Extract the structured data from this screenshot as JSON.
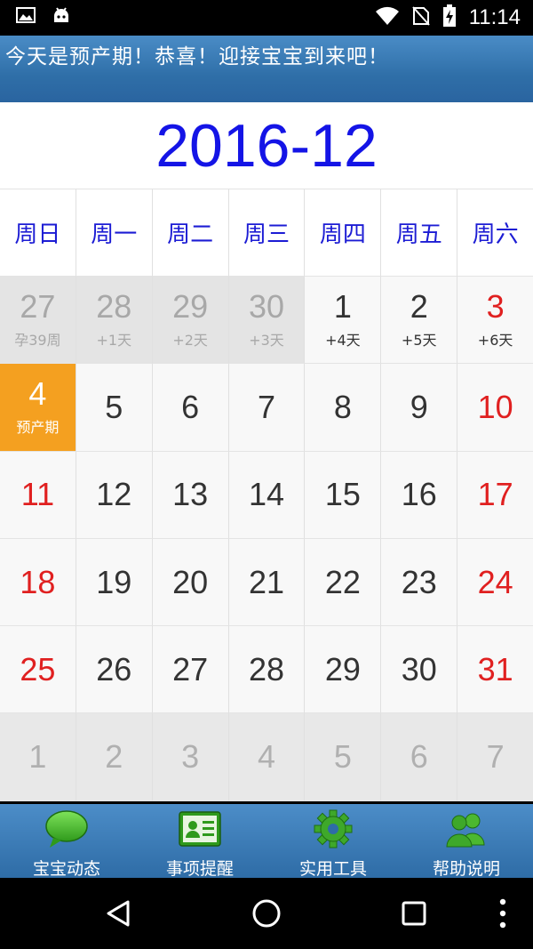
{
  "status_bar": {
    "time": "11:14",
    "icons": [
      "image-icon",
      "android-icon",
      "wifi-icon",
      "no-sim-icon",
      "battery-charging-icon"
    ]
  },
  "banner": {
    "text": "今天是预产期！恭喜！迎接宝宝到来吧！"
  },
  "calendar": {
    "month_title": "2016-12",
    "weekdays": [
      "周日",
      "周一",
      "周二",
      "周三",
      "周四",
      "周五",
      "周六"
    ],
    "weeks": [
      [
        {
          "day": "27",
          "sub": "孕39周",
          "type": "prev"
        },
        {
          "day": "28",
          "sub": "+1天",
          "type": "prev"
        },
        {
          "day": "29",
          "sub": "+2天",
          "type": "prev"
        },
        {
          "day": "30",
          "sub": "+3天",
          "type": "prev"
        },
        {
          "day": "1",
          "sub": "+4天",
          "type": "current"
        },
        {
          "day": "2",
          "sub": "+5天",
          "type": "current"
        },
        {
          "day": "3",
          "sub": "+6天",
          "type": "weekend"
        }
      ],
      [
        {
          "day": "4",
          "sub": "预产期",
          "type": "today"
        },
        {
          "day": "5",
          "sub": "",
          "type": "current"
        },
        {
          "day": "6",
          "sub": "",
          "type": "current"
        },
        {
          "day": "7",
          "sub": "",
          "type": "current"
        },
        {
          "day": "8",
          "sub": "",
          "type": "current"
        },
        {
          "day": "9",
          "sub": "",
          "type": "current"
        },
        {
          "day": "10",
          "sub": "",
          "type": "weekend"
        }
      ],
      [
        {
          "day": "11",
          "sub": "",
          "type": "weekend"
        },
        {
          "day": "12",
          "sub": "",
          "type": "current"
        },
        {
          "day": "13",
          "sub": "",
          "type": "current"
        },
        {
          "day": "14",
          "sub": "",
          "type": "current"
        },
        {
          "day": "15",
          "sub": "",
          "type": "current"
        },
        {
          "day": "16",
          "sub": "",
          "type": "current"
        },
        {
          "day": "17",
          "sub": "",
          "type": "weekend"
        }
      ],
      [
        {
          "day": "18",
          "sub": "",
          "type": "weekend"
        },
        {
          "day": "19",
          "sub": "",
          "type": "current"
        },
        {
          "day": "20",
          "sub": "",
          "type": "current"
        },
        {
          "day": "21",
          "sub": "",
          "type": "current"
        },
        {
          "day": "22",
          "sub": "",
          "type": "current"
        },
        {
          "day": "23",
          "sub": "",
          "type": "current"
        },
        {
          "day": "24",
          "sub": "",
          "type": "weekend"
        }
      ],
      [
        {
          "day": "25",
          "sub": "",
          "type": "weekend"
        },
        {
          "day": "26",
          "sub": "",
          "type": "current"
        },
        {
          "day": "27",
          "sub": "",
          "type": "current"
        },
        {
          "day": "28",
          "sub": "",
          "type": "current"
        },
        {
          "day": "29",
          "sub": "",
          "type": "current"
        },
        {
          "day": "30",
          "sub": "",
          "type": "current"
        },
        {
          "day": "31",
          "sub": "",
          "type": "weekend"
        }
      ],
      [
        {
          "day": "1",
          "sub": "",
          "type": "next"
        },
        {
          "day": "2",
          "sub": "",
          "type": "next"
        },
        {
          "day": "3",
          "sub": "",
          "type": "next"
        },
        {
          "day": "4",
          "sub": "",
          "type": "next"
        },
        {
          "day": "5",
          "sub": "",
          "type": "next"
        },
        {
          "day": "6",
          "sub": "",
          "type": "next"
        },
        {
          "day": "7",
          "sub": "",
          "type": "next"
        }
      ]
    ]
  },
  "bottom_nav": {
    "items": [
      {
        "label": "宝宝动态",
        "icon": "chat-bubble-icon"
      },
      {
        "label": "事项提醒",
        "icon": "id-card-icon"
      },
      {
        "label": "实用工具",
        "icon": "gear-icon"
      },
      {
        "label": "帮助说明",
        "icon": "people-icon"
      }
    ]
  },
  "system_nav": {
    "buttons": [
      "back-icon",
      "home-icon",
      "recents-icon",
      "more-icon"
    ]
  },
  "colors": {
    "banner": "#2f6fa8",
    "month_title": "#1414e6",
    "weekday": "#1c1cd4",
    "weekend_day": "#e02020",
    "today_bg": "#f4a020",
    "muted_day": "#a8a8a8"
  }
}
